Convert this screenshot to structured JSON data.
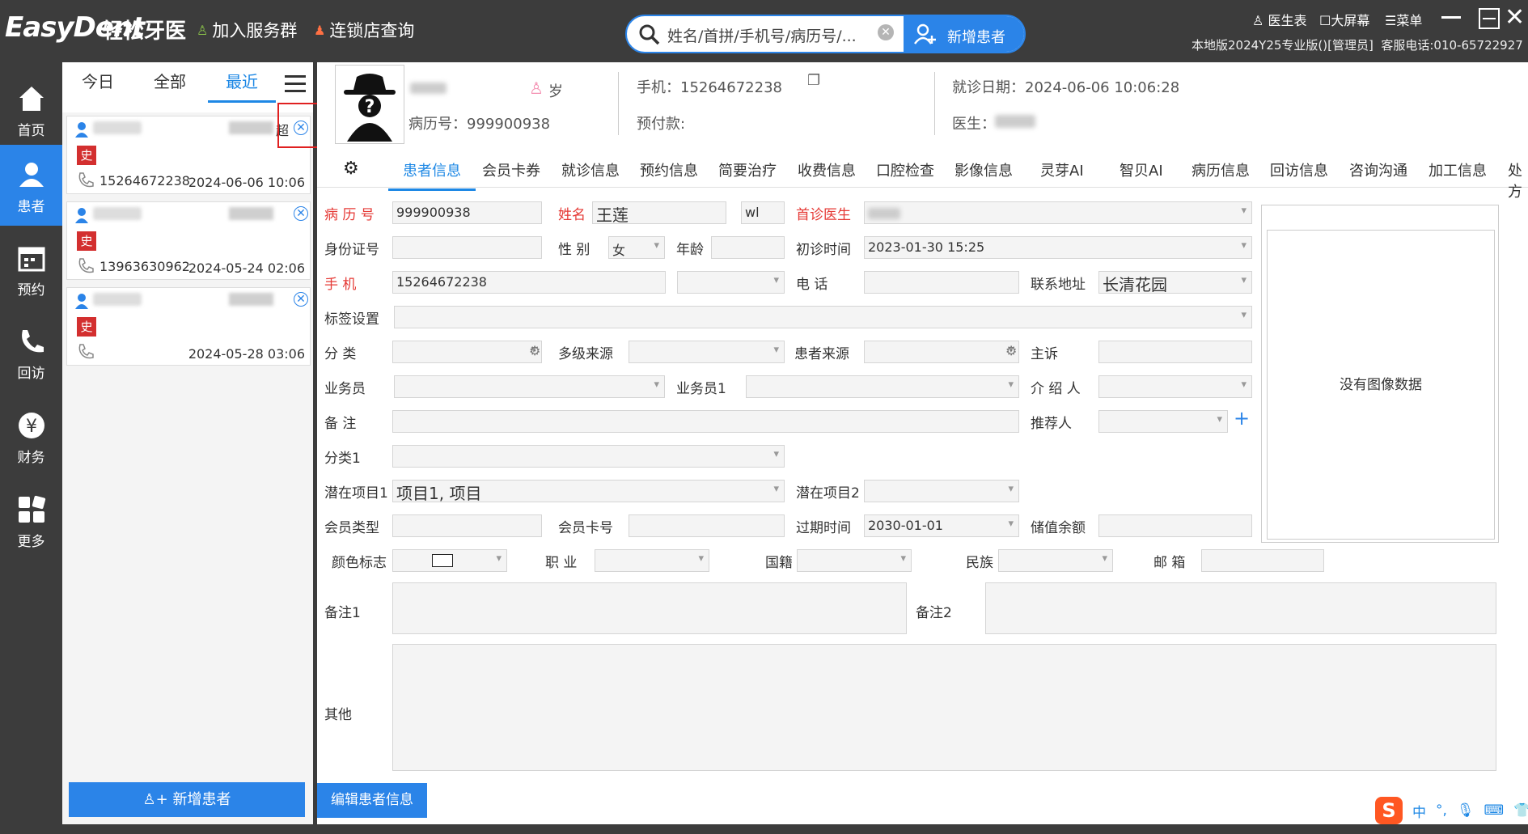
{
  "topbar": {
    "logo": "EasyDent",
    "logo_cn": "轻松牙医",
    "join_group": "加入服务群",
    "chain_query": "连锁店查询",
    "search_placeholder": "姓名/首拼/手机号/病历号/...",
    "new_patient": "新增患者",
    "doctor_table": "医生表",
    "big_screen": "大屏幕",
    "menu": "菜单",
    "version_info": "本地版2024Y25专业版()[管理员]  客服电话:010-65722927"
  },
  "sidebar": {
    "items": [
      {
        "label": "首页",
        "icon": "home-icon"
      },
      {
        "label": "患者",
        "icon": "patient-icon"
      },
      {
        "label": "预约",
        "icon": "calendar-icon"
      },
      {
        "label": "回访",
        "icon": "phone-icon"
      },
      {
        "label": "财务",
        "icon": "yen-icon"
      },
      {
        "label": "更多",
        "icon": "grid-icon"
      }
    ]
  },
  "list": {
    "tabs": [
      "今日",
      "全部",
      "最近"
    ],
    "cards": [
      {
        "name_suffix": "超",
        "tag": "史",
        "phone": "15264672238",
        "date": "2024-06-06 10:06"
      },
      {
        "name_suffix": "",
        "tag": "史",
        "phone": "13963630962",
        "date": "2024-05-24 02:06"
      },
      {
        "name_suffix": "",
        "tag": "史",
        "phone": "",
        "date": "2024-05-28 03:06"
      }
    ],
    "add_button": "新增患者"
  },
  "header": {
    "age_label": "岁",
    "record_no": "病历号：999900938",
    "mobile": "手机：15264672238",
    "prepay": "预付款:",
    "visit_date": "就诊日期：2024-06-06 10:06:28",
    "doctor": "医生："
  },
  "tabs": [
    "患者信息",
    "会员卡券",
    "就诊信息",
    "预约信息",
    "简要治疗",
    "收费信息",
    "口腔检查",
    "影像信息",
    "灵芽AI",
    "智贝AI",
    "病历信息",
    "回访信息",
    "咨询沟通",
    "加工信息",
    "处方"
  ],
  "form": {
    "record_no_label": "病 历 号",
    "record_no": "999900938",
    "name_label": "姓名",
    "name": "王莲",
    "short": "wl",
    "first_doctor_label": "首诊医生",
    "id_label": "身份证号",
    "gender_label": "性 别",
    "gender": "女",
    "age_label": "年龄",
    "first_visit_label": "初诊时间",
    "first_visit": "2023-01-30 15:25",
    "mobile_label": "手 机",
    "mobile": "15264672238",
    "tel_label": "电 话",
    "address_label": "联系地址",
    "address": "长清花园",
    "tags_label": "标签设置",
    "category_label": "分 类",
    "multi_source_label": "多级来源",
    "patient_source_label": "患者来源",
    "complaint_label": "主诉",
    "salesman_label": "业务员",
    "salesman1_label": "业务员1",
    "introducer_label": "介 绍 人",
    "remark_label": "备 注",
    "referrer_label": "推荐人",
    "category1_label": "分类1",
    "potential1_label": "潜在项目1",
    "potential1": "项目1, 项目",
    "potential2_label": "潜在项目2",
    "member_type_label": "会员类型",
    "card_no_label": "会员卡号",
    "expire_label": "过期时间",
    "expire": "2030-01-01",
    "balance_label": "储值余额",
    "color_label": "颜色标志",
    "job_label": "职 业",
    "nation_label": "国籍",
    "ethnic_label": "民族",
    "email_label": "邮 箱",
    "remark1_label": "备注1",
    "remark2_label": "备注2",
    "other_label": "其他",
    "no_image": "没有图像数据"
  },
  "edit_button": "编辑患者信息",
  "ime": {
    "chinese": "中"
  }
}
